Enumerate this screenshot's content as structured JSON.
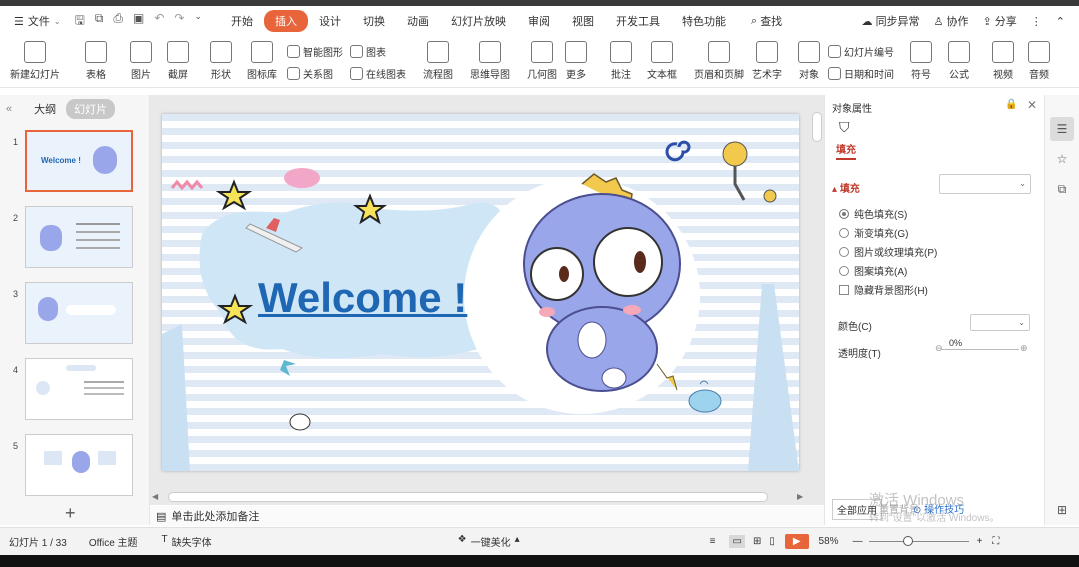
{
  "menubar": {
    "file_label": "文件",
    "tabs": [
      "开始",
      "插入",
      "设计",
      "切换",
      "动画",
      "幻灯片放映",
      "审阅",
      "视图",
      "开发工具",
      "特色功能"
    ],
    "active_tab": "插入",
    "find_label": "查找",
    "sync_label": "同步异常",
    "collab_label": "协作",
    "share_label": "分享"
  },
  "ribbon": {
    "new_slide": "新建幻灯片",
    "table": "表格",
    "picture": "图片",
    "screenshot": "截屏",
    "shape": "形状",
    "icon_lib": "图标库",
    "smart_graphic": "智能图形",
    "relation": "关系图",
    "chart": "图表",
    "online_chart": "在线图表",
    "flowchart": "流程图",
    "mindmap": "思维导图",
    "geometry": "几何图",
    "more": "更多",
    "comment": "批注",
    "textbox": "文本框",
    "header_footer": "页眉和页脚",
    "wordart": "艺术字",
    "object": "对象",
    "slide_number": "幻灯片编号",
    "datetime": "日期和时间",
    "symbol": "符号",
    "formula": "公式",
    "video": "视频",
    "audio": "音频"
  },
  "leftpane": {
    "tab_outline": "大纲",
    "tab_slides": "幻灯片",
    "slide_numbers": [
      "1",
      "2",
      "3",
      "4",
      "5"
    ]
  },
  "slide": {
    "title": "Welcome !"
  },
  "notes": {
    "placeholder": "单击此处添加备注"
  },
  "rpanel": {
    "header": "对象属性",
    "tab_fill": "填充",
    "section_fill": "填充",
    "options": [
      "纯色填充(S)",
      "渐变填充(G)",
      "图片或纹理填充(P)",
      "图案填充(A)"
    ],
    "hide_bg": "隐藏背景图形(H)",
    "color_label": "颜色(C)",
    "transparency_label": "透明度(T)",
    "transparency_value": "0%",
    "apply_all": "全部应用",
    "reset": "重置背景",
    "tips": "操作技巧"
  },
  "watermark": {
    "line1": "激活 Windows",
    "line2": "转到\"设置\"以激活 Windows。"
  },
  "status": {
    "slide_counter": "幻灯片 1 / 33",
    "theme": "Office 主题",
    "missing_font": "缺失字体",
    "beautify": "一键美化",
    "zoom": "58%"
  },
  "colors": {
    "accent": "#e8643a",
    "title_blue": "#1f66b3",
    "dino": "#9aa6ea"
  }
}
